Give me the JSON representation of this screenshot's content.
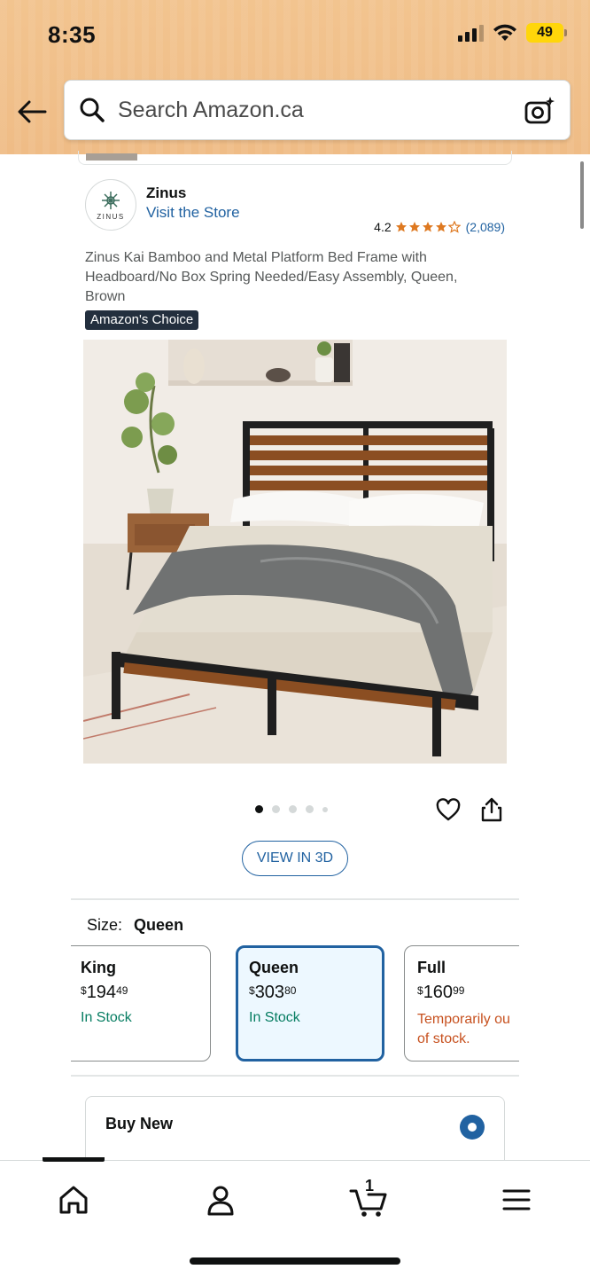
{
  "status_bar": {
    "time": "8:35",
    "battery": "49"
  },
  "search": {
    "placeholder": "Search Amazon.ca"
  },
  "brand": {
    "logo_text": "ZINUS",
    "name": "Zinus",
    "store_link": "Visit the Store"
  },
  "rating": {
    "value": "4.2",
    "stars": 4.2,
    "count": "(2,089)"
  },
  "product": {
    "title": "Zinus Kai Bamboo and Metal Platform Bed Frame with Headboard/No Box Spring Needed/Easy Assembly, Queen, Brown",
    "badge": "Amazon's Choice",
    "image_count": 5,
    "active_image": 1
  },
  "actions": {
    "view_3d": "VIEW IN 3D"
  },
  "size": {
    "label": "Size:",
    "selected": "Queen",
    "options": [
      {
        "name": "King",
        "currency": "$",
        "dollars": "194",
        "cents": "49",
        "stock": "In Stock",
        "status": "in"
      },
      {
        "name": "Queen",
        "currency": "$",
        "dollars": "303",
        "cents": "80",
        "stock": "In Stock",
        "status": "in"
      },
      {
        "name": "Full",
        "currency": "$",
        "dollars": "160",
        "cents": "99",
        "stock": "Temporarily out of stock.",
        "stock_line1": "Temporarily ou",
        "stock_line2": "of stock.",
        "status": "out"
      }
    ]
  },
  "purchase": {
    "buy_new": "Buy New"
  },
  "bottom_nav": {
    "cart_count": "1",
    "items": [
      "home-icon",
      "account-icon",
      "cart-icon",
      "menu-icon"
    ]
  },
  "colors": {
    "link": "#2162a1",
    "in_stock": "#067d62",
    "out_of_stock": "#c7511f",
    "header": "#f0c08a",
    "badge": "#232f3e"
  }
}
